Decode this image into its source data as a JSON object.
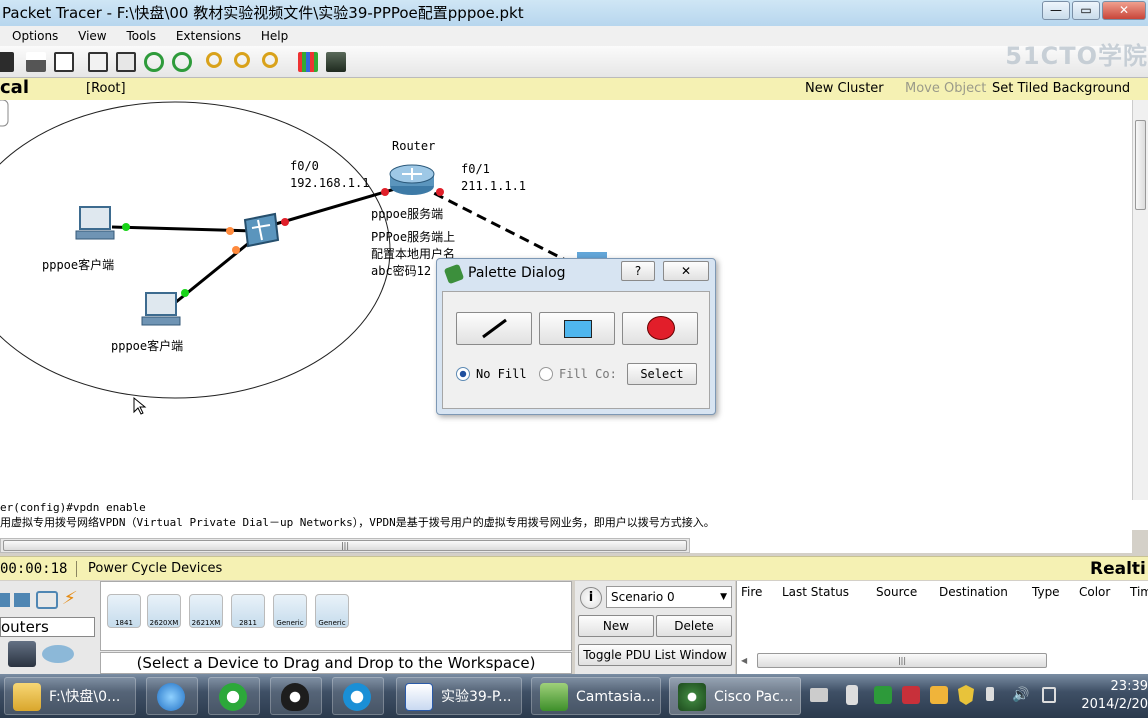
{
  "window": {
    "title": "Packet Tracer - F:\\快盘\\00 教材实验视频文件\\实验39-PPPoe配置pppoe.pkt",
    "minimize": "—",
    "maximize": "▭",
    "close": "✕"
  },
  "menu": [
    "Options",
    "View",
    "Tools",
    "Extensions",
    "Help"
  ],
  "watermark": "51CTO学院",
  "workspace_bar": {
    "mode": "cal",
    "root": "[Root]",
    "new_cluster": "New Cluster",
    "move_object": "Move Object",
    "set_tiled": "Set Tiled Background"
  },
  "topology": {
    "router_name": "Router",
    "f00_label": "f0/0",
    "f00_ip": "192.168.1.1",
    "f01_label": "f0/1",
    "f01_ip": "211.1.1.1",
    "router_role": "pppoe服务端",
    "note_line1": "PPPoe服务端上",
    "note_line2": "配置本地用户名",
    "note_line3": "abc密码12",
    "pc1_label": "pppoe客户端",
    "pc2_label": "pppoe客户端"
  },
  "palette": {
    "title": "Palette Dialog",
    "help": "?",
    "close": "✕",
    "no_fill": "No Fill",
    "fill_color": "Fill Co:",
    "select": "Select"
  },
  "console": {
    "line1": "er(config)#vpdn enable",
    "line2": "用虚拟专用拨号网络VPDN（Virtual Private Dial－up Networks），VPDN是基于拨号用户的虚拟专用拨号网业务，即用户以拨号方式接入。",
    "scroll_grip": "|||"
  },
  "statusbar": {
    "time": "00:00:18",
    "power_cycle": "Power Cycle Devices",
    "realtime": "Realti"
  },
  "device_panel": {
    "category": "outers",
    "models": [
      "1841",
      "2620XM",
      "2621XM",
      "2811",
      "Generic",
      "Generic"
    ],
    "hint": "(Select a Device to Drag and Drop to the Workspace)"
  },
  "pdu_panel": {
    "info": "i",
    "scenario": "Scenario 0",
    "new": "New",
    "delete": "Delete",
    "toggle": "Toggle PDU List Window"
  },
  "event_table": {
    "columns": [
      "Fire",
      "Last Status",
      "Source",
      "Destination",
      "Type",
      "Color",
      "Tim"
    ],
    "scroll_grip": "|||"
  },
  "taskbar": {
    "items": [
      "F:\\快盘\\0...",
      "",
      "",
      "",
      "",
      "实验39-P...",
      "Camtasia...",
      "Cisco Pac..."
    ],
    "time": "23:39",
    "date": "2014/2/20"
  },
  "colors": {
    "link_up": "#18d418",
    "link_mid": "#ff8a3d",
    "link_down": "#e0202a",
    "statusbar_bg": "#f5f1b3",
    "palette_red": "#e21e2a",
    "palette_blue": "#4fb6ee"
  },
  "icons": [
    "save-icon",
    "print-icon",
    "edit-icon",
    "copy-icon",
    "paste-icon",
    "undo-icon",
    "redo-icon",
    "zoom-in-icon",
    "zoom-reset-icon",
    "zoom-out-icon",
    "palette-icon",
    "custom-device-icon"
  ]
}
